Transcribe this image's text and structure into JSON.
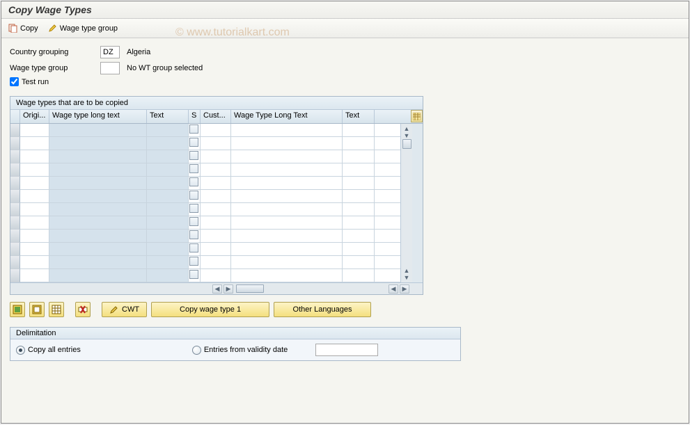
{
  "title": "Copy Wage Types",
  "watermark": "© www.tutorialkart.com",
  "toolbar": {
    "copy_label": "Copy",
    "wtgroup_label": "Wage type group"
  },
  "form": {
    "country_label": "Country grouping",
    "country_code": "DZ",
    "country_name": "Algeria",
    "wtgroup_label": "Wage type group",
    "wtgroup_value": "",
    "wtgroup_desc": "No WT group selected",
    "testrun_label": "Test run",
    "testrun_checked": true
  },
  "grid": {
    "panel_title": "Wage types that are to be copied",
    "columns": {
      "origi": "Origi...",
      "longtext1": "Wage type long text",
      "text1": "Text",
      "s": "S",
      "cust": "Cust...",
      "longtext2": "Wage Type Long Text",
      "text2": "Text"
    },
    "row_count": 12
  },
  "buttons": {
    "cwt_label": "CWT",
    "copy1_label": "Copy wage type 1",
    "otherlang_label": "Other Languages"
  },
  "delim": {
    "title": "Delimitation",
    "copy_all_label": "Copy all entries",
    "from_date_label": "Entries from validity date",
    "date_value": ""
  }
}
